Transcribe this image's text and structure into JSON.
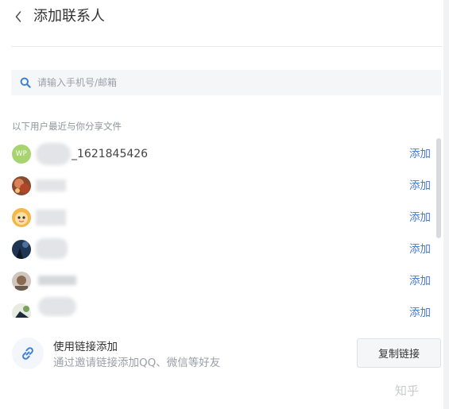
{
  "header": {
    "title": "添加联系人"
  },
  "search": {
    "placeholder": "请输入手机号/邮箱",
    "value": ""
  },
  "section_label": "以下用户最近与你分享文件",
  "users": [
    {
      "avatar": "WP",
      "name_suffix": "_1621845426",
      "add_label": "添加"
    },
    {
      "avatar": "photo-avatar",
      "name_suffix": "",
      "add_label": "添加"
    },
    {
      "avatar": "photo-avatar",
      "name_suffix": "",
      "add_label": "添加"
    },
    {
      "avatar": "photo-avatar",
      "name_suffix": "",
      "add_label": "添加"
    },
    {
      "avatar": "photo-avatar",
      "name_suffix": "",
      "add_label": "添加"
    },
    {
      "avatar": "photo-avatar",
      "name_suffix": "",
      "add_label": "添加"
    }
  ],
  "invite": {
    "title": "使用链接添加",
    "subtitle": "通过邀请链接添加QQ、微信等好友",
    "copy_label": "复制链接"
  },
  "watermark": "知乎",
  "colors": {
    "accent": "#4a7cc7",
    "search_icon": "#3f7fd6",
    "wp_avatar": "#a7d46f"
  },
  "icons": {
    "back": "chevron-left-icon",
    "search": "search-icon",
    "invite": "link-icon"
  }
}
